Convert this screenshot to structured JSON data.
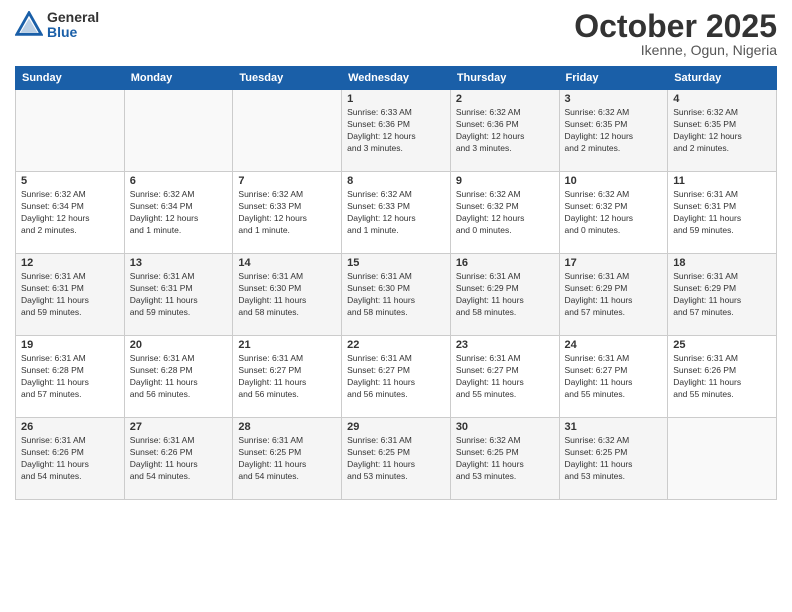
{
  "header": {
    "logo_general": "General",
    "logo_blue": "Blue",
    "month": "October 2025",
    "location": "Ikenne, Ogun, Nigeria"
  },
  "days_of_week": [
    "Sunday",
    "Monday",
    "Tuesday",
    "Wednesday",
    "Thursday",
    "Friday",
    "Saturday"
  ],
  "weeks": [
    [
      {
        "day": "",
        "info": ""
      },
      {
        "day": "",
        "info": ""
      },
      {
        "day": "",
        "info": ""
      },
      {
        "day": "1",
        "info": "Sunrise: 6:33 AM\nSunset: 6:36 PM\nDaylight: 12 hours\nand 3 minutes."
      },
      {
        "day": "2",
        "info": "Sunrise: 6:32 AM\nSunset: 6:36 PM\nDaylight: 12 hours\nand 3 minutes."
      },
      {
        "day": "3",
        "info": "Sunrise: 6:32 AM\nSunset: 6:35 PM\nDaylight: 12 hours\nand 2 minutes."
      },
      {
        "day": "4",
        "info": "Sunrise: 6:32 AM\nSunset: 6:35 PM\nDaylight: 12 hours\nand 2 minutes."
      }
    ],
    [
      {
        "day": "5",
        "info": "Sunrise: 6:32 AM\nSunset: 6:34 PM\nDaylight: 12 hours\nand 2 minutes."
      },
      {
        "day": "6",
        "info": "Sunrise: 6:32 AM\nSunset: 6:34 PM\nDaylight: 12 hours\nand 1 minute."
      },
      {
        "day": "7",
        "info": "Sunrise: 6:32 AM\nSunset: 6:33 PM\nDaylight: 12 hours\nand 1 minute."
      },
      {
        "day": "8",
        "info": "Sunrise: 6:32 AM\nSunset: 6:33 PM\nDaylight: 12 hours\nand 1 minute."
      },
      {
        "day": "9",
        "info": "Sunrise: 6:32 AM\nSunset: 6:32 PM\nDaylight: 12 hours\nand 0 minutes."
      },
      {
        "day": "10",
        "info": "Sunrise: 6:32 AM\nSunset: 6:32 PM\nDaylight: 12 hours\nand 0 minutes."
      },
      {
        "day": "11",
        "info": "Sunrise: 6:31 AM\nSunset: 6:31 PM\nDaylight: 11 hours\nand 59 minutes."
      }
    ],
    [
      {
        "day": "12",
        "info": "Sunrise: 6:31 AM\nSunset: 6:31 PM\nDaylight: 11 hours\nand 59 minutes."
      },
      {
        "day": "13",
        "info": "Sunrise: 6:31 AM\nSunset: 6:31 PM\nDaylight: 11 hours\nand 59 minutes."
      },
      {
        "day": "14",
        "info": "Sunrise: 6:31 AM\nSunset: 6:30 PM\nDaylight: 11 hours\nand 58 minutes."
      },
      {
        "day": "15",
        "info": "Sunrise: 6:31 AM\nSunset: 6:30 PM\nDaylight: 11 hours\nand 58 minutes."
      },
      {
        "day": "16",
        "info": "Sunrise: 6:31 AM\nSunset: 6:29 PM\nDaylight: 11 hours\nand 58 minutes."
      },
      {
        "day": "17",
        "info": "Sunrise: 6:31 AM\nSunset: 6:29 PM\nDaylight: 11 hours\nand 57 minutes."
      },
      {
        "day": "18",
        "info": "Sunrise: 6:31 AM\nSunset: 6:29 PM\nDaylight: 11 hours\nand 57 minutes."
      }
    ],
    [
      {
        "day": "19",
        "info": "Sunrise: 6:31 AM\nSunset: 6:28 PM\nDaylight: 11 hours\nand 57 minutes."
      },
      {
        "day": "20",
        "info": "Sunrise: 6:31 AM\nSunset: 6:28 PM\nDaylight: 11 hours\nand 56 minutes."
      },
      {
        "day": "21",
        "info": "Sunrise: 6:31 AM\nSunset: 6:27 PM\nDaylight: 11 hours\nand 56 minutes."
      },
      {
        "day": "22",
        "info": "Sunrise: 6:31 AM\nSunset: 6:27 PM\nDaylight: 11 hours\nand 56 minutes."
      },
      {
        "day": "23",
        "info": "Sunrise: 6:31 AM\nSunset: 6:27 PM\nDaylight: 11 hours\nand 55 minutes."
      },
      {
        "day": "24",
        "info": "Sunrise: 6:31 AM\nSunset: 6:27 PM\nDaylight: 11 hours\nand 55 minutes."
      },
      {
        "day": "25",
        "info": "Sunrise: 6:31 AM\nSunset: 6:26 PM\nDaylight: 11 hours\nand 55 minutes."
      }
    ],
    [
      {
        "day": "26",
        "info": "Sunrise: 6:31 AM\nSunset: 6:26 PM\nDaylight: 11 hours\nand 54 minutes."
      },
      {
        "day": "27",
        "info": "Sunrise: 6:31 AM\nSunset: 6:26 PM\nDaylight: 11 hours\nand 54 minutes."
      },
      {
        "day": "28",
        "info": "Sunrise: 6:31 AM\nSunset: 6:25 PM\nDaylight: 11 hours\nand 54 minutes."
      },
      {
        "day": "29",
        "info": "Sunrise: 6:31 AM\nSunset: 6:25 PM\nDaylight: 11 hours\nand 53 minutes."
      },
      {
        "day": "30",
        "info": "Sunrise: 6:32 AM\nSunset: 6:25 PM\nDaylight: 11 hours\nand 53 minutes."
      },
      {
        "day": "31",
        "info": "Sunrise: 6:32 AM\nSunset: 6:25 PM\nDaylight: 11 hours\nand 53 minutes."
      },
      {
        "day": "",
        "info": ""
      }
    ]
  ]
}
